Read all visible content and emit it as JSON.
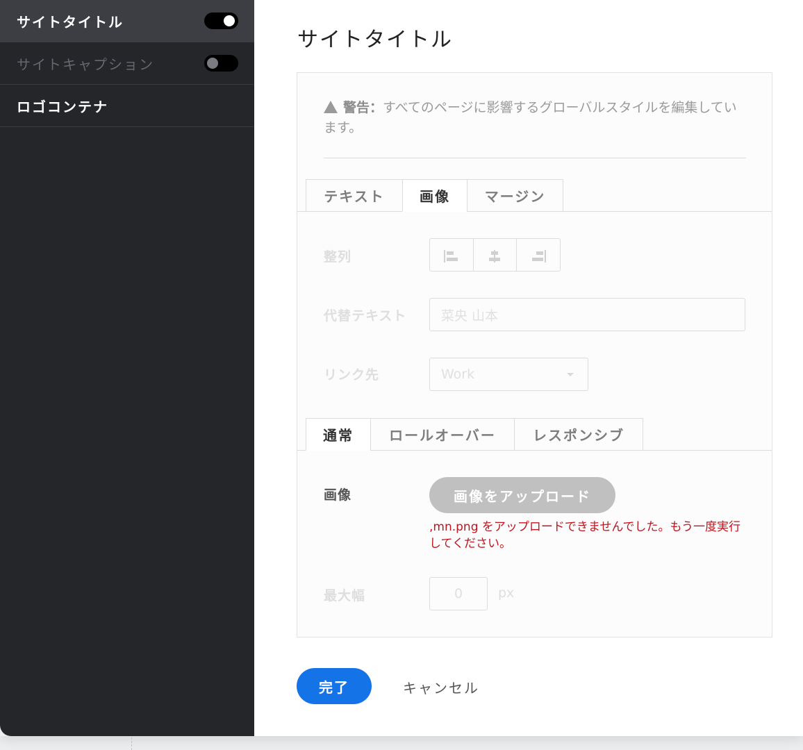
{
  "sidebar": {
    "items": [
      {
        "label": "サイトタイトル",
        "toggle": "on"
      },
      {
        "label": "サイトキャプション",
        "toggle": "off"
      },
      {
        "label": "ロゴコンテナ"
      }
    ]
  },
  "main": {
    "title": "サイトタイトル",
    "warning": {
      "prefix": "警告：",
      "text": "すべてのページに影響するグローバルスタイルを編集しています。"
    },
    "tabs_top": [
      "テキスト",
      "画像",
      "マージン"
    ],
    "tabs_top_active": "画像",
    "fields": {
      "align_label": "整列",
      "alt_label": "代替テキスト",
      "alt_value": "菜央 山本",
      "link_label": "リンク先",
      "link_value": "Work"
    },
    "tabs_state": [
      "通常",
      "ロールオーバー",
      "レスポンシブ"
    ],
    "tabs_state_active": "通常",
    "image_label": "画像",
    "upload_button": "画像をアップロード",
    "error": ",mn.png をアップロードできませんでした。もう一度実行してください。",
    "maxwidth_label": "最大幅",
    "maxwidth_value": "0",
    "maxwidth_unit": "px"
  },
  "footer": {
    "done": "完了",
    "cancel": "キャンセル"
  },
  "colors": {
    "accent": "#1473e6",
    "error": "#c0141e",
    "sidebar_bg": "#25262a"
  }
}
